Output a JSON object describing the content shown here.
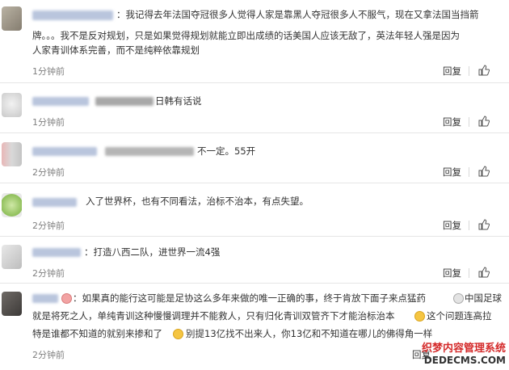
{
  "comments": [
    {
      "lines": [
        "：我记得去年法国夺冠很多人觉得人家是靠黑人夺冠很多人不服气，现在又拿法国当挡箭",
        "牌。。。我不是反对规划，只是如果觉得规划就能立即出成绩的话美国人应该无敌了，英法年轻人强是因为",
        "人家青训体系完善，而不是纯粹依靠规划"
      ],
      "time": "1分钟前",
      "reply": "回复"
    },
    {
      "lines": [
        "日韩有话说"
      ],
      "time": "1分钟前",
      "reply": "回复"
    },
    {
      "lines": [
        "不一定。55开"
      ],
      "time": "2分钟前",
      "reply": "回复"
    },
    {
      "lines": [
        "入了世界杯，也有不同看法，治标不治本，有点失望。"
      ],
      "time": "2分钟前",
      "reply": "回复"
    },
    {
      "lines": [
        "：打造八西二队，进世界一流4强"
      ],
      "time": "2分钟前",
      "reply": "回复"
    },
    {
      "lines": [
        "：如果真的能行这可能是足协这么多年来做的唯一正确的事，终于肯放下面子来点猛药",
        "中国足球",
        "就是将死之人，单纯青训这种慢慢调理并不能救人，只有归化青训双管齐下才能治标治本",
        "这个问题连高拉",
        "特是谁都不知道的就别来掺和了",
        "别提13亿找不出来人，你13亿和不知道在哪儿的佛得角一样"
      ],
      "time": "2分钟前",
      "reply": "回复"
    }
  ],
  "watermark": {
    "line1": "织梦内容管理系统",
    "line2": "DEDECMS.COM"
  },
  "colors": {
    "text": "#333333",
    "meta": "#808080",
    "divider": "#e6e6e6",
    "watermark_red": "#d42a2a"
  },
  "icons": {
    "like": "thumbs-up-icon"
  }
}
